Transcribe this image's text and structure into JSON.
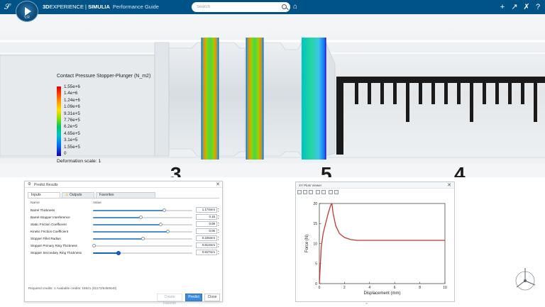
{
  "topbar": {
    "brand_bold": "3D",
    "brand_experience": "EXPERIENCE",
    "brand_separator": " | ",
    "brand_app": "SIMULIA",
    "brand_sub": "Performance Guide",
    "compass_version": "V,R",
    "search_placeholder": "Search",
    "icons": [
      "plus-icon",
      "share-icon",
      "tools-icon",
      "help-icon"
    ],
    "icon_glyphs": [
      "+",
      "↗",
      "✗",
      "?"
    ]
  },
  "viewport": {
    "legend_title": "Contact Pressure Stopper-Plunger (N_m2)",
    "legend_labels": [
      "1.55e+6",
      "1.4e+6",
      "1.24e+6",
      "1.09e+6",
      "9.31e+5",
      "7.76e+5",
      "6.2e+5",
      "4.65e+5",
      "3.1e+5",
      "1.55e+5",
      "0"
    ],
    "deformation": "Deformation scale: 1",
    "syringe_marks": [
      "3",
      "5",
      "4"
    ]
  },
  "predict_dialog": {
    "title": "Predict Results",
    "close_glyph": "✕",
    "tabs": [
      {
        "label": "Inputs",
        "active": true
      },
      {
        "label": "Outputs",
        "active": false,
        "warning": true
      },
      {
        "label": "Favorites",
        "active": false
      }
    ],
    "columns": {
      "name": "Name",
      "value": "Value"
    },
    "rows": [
      {
        "name": "Barrel Thickness",
        "value": "1.174mm",
        "fraction": 0.72
      },
      {
        "name": "Barrel-Stopper Interference",
        "value": "0.15",
        "fraction": 0.48
      },
      {
        "name": "Static Friction Coefficient",
        "value": "0.08",
        "fraction": 0.68
      },
      {
        "name": "Kinetic Friction Coefficient",
        "value": "0.06",
        "fraction": 0.75
      },
      {
        "name": "Stopper Fillet Radius",
        "value": "0.225mm",
        "fraction": 0.5
      },
      {
        "name": "Stopper Primary Ring Thickness",
        "value": "0.814mm",
        "fraction": 0.01
      },
      {
        "name": "Stopper Secondary Ring Thickness",
        "value": "0.817mm",
        "fraction": 0.25,
        "active": true
      }
    ],
    "credits": "Required credits: 1   Available credits: 19521 (61172/5450640)",
    "buttons": {
      "create_favorite": "Create Favorite",
      "predict": "Predict",
      "close": "Close"
    }
  },
  "plots_viewer": {
    "title": "XY Plots Viewer",
    "close_glyph": "✕",
    "toolbar_icons": [
      "grid-icon",
      "zoom-fit-icon",
      "zoom-icon",
      "cursor-icon",
      "line-icon",
      "print-icon",
      "export-icon"
    ]
  },
  "chart_data": {
    "type": "line",
    "title": "",
    "xlabel": "Displacement (mm)",
    "ylabel": "Force (N)",
    "xlim": [
      0,
      10
    ],
    "ylim": [
      0,
      20
    ],
    "xticks": [
      0,
      2,
      4,
      6,
      8,
      10
    ],
    "yticks": [
      0,
      5,
      10,
      15,
      20
    ],
    "grid": false,
    "series": [
      {
        "color": "#c0392b",
        "x": [
          0.0,
          0.05,
          0.15,
          0.3,
          0.5,
          0.7,
          0.9,
          1.0,
          1.1,
          1.3,
          1.6,
          2.0,
          2.5,
          3.0,
          4.0,
          5.0,
          6.0,
          7.0,
          8.0,
          9.0,
          10.0
        ],
        "y": [
          0.0,
          3.0,
          9.0,
          12.5,
          15.0,
          17.5,
          19.5,
          20.0,
          17.5,
          14.5,
          12.5,
          11.5,
          11.0,
          10.8,
          10.8,
          10.8,
          10.8,
          10.8,
          10.8,
          10.8,
          10.8
        ]
      }
    ]
  },
  "colors": {
    "topbar": "#005386",
    "accent": "#3a8ad6",
    "curve": "#c0392b"
  }
}
